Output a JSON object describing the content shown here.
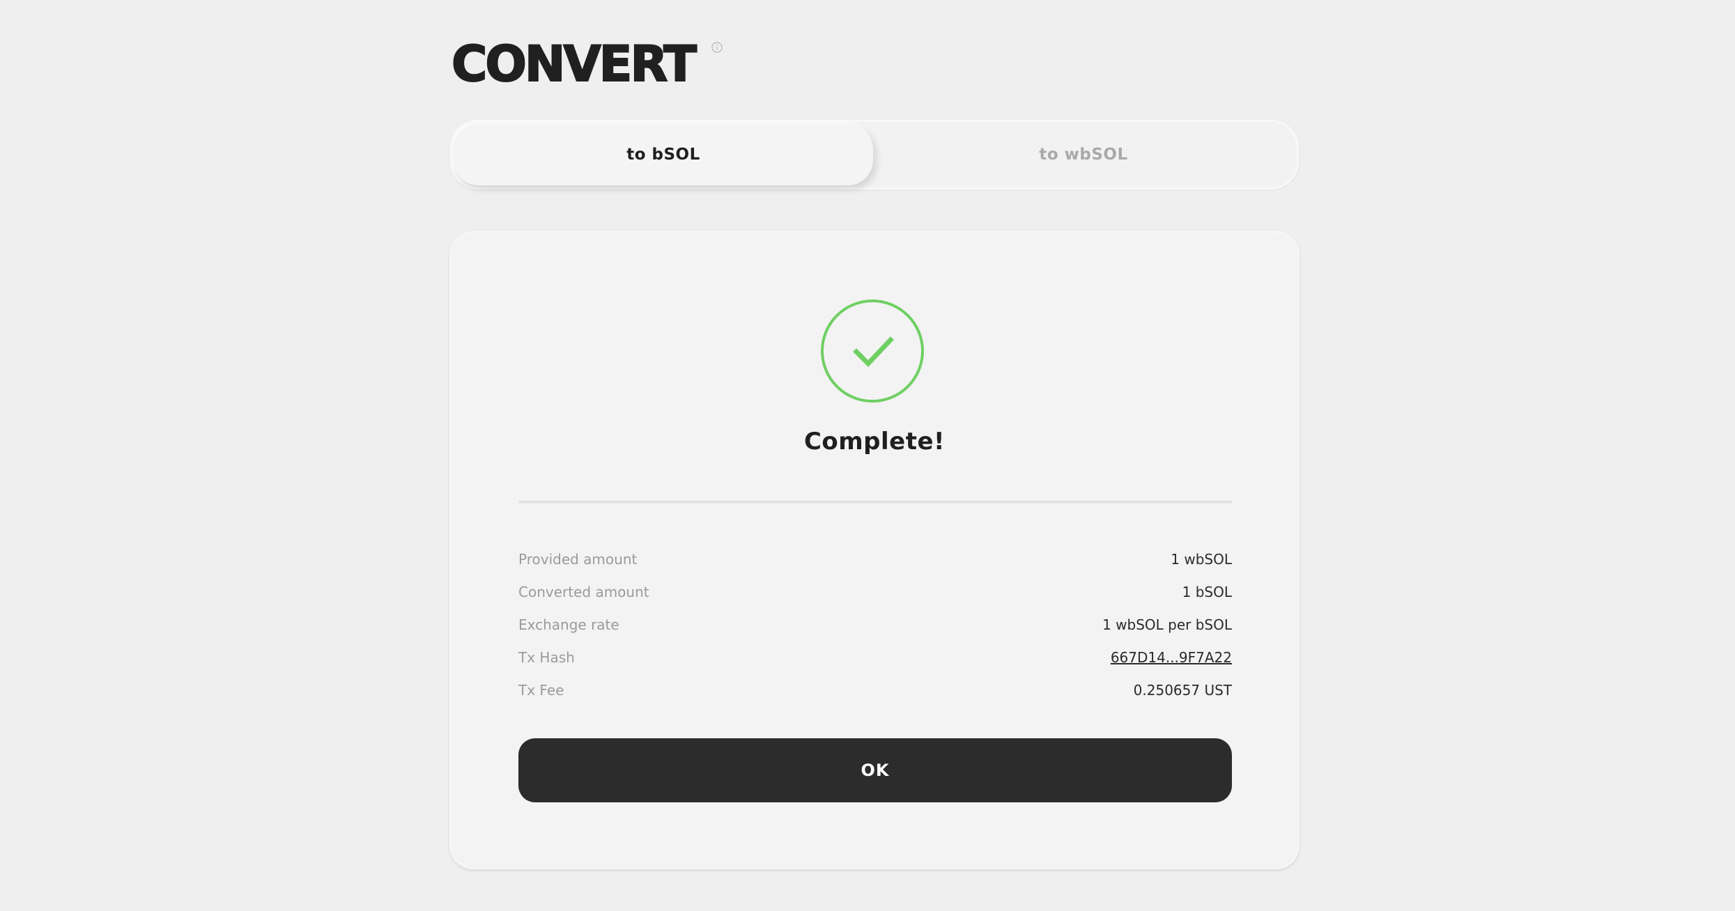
{
  "header": {
    "title": "CONVERT",
    "info_icon": "info-circle-icon"
  },
  "tabs": [
    {
      "label": "to bSOL",
      "active": true
    },
    {
      "label": "to wbSOL",
      "active": false
    }
  ],
  "result": {
    "icon": "check-circle-icon",
    "status": "Complete!",
    "rows": [
      {
        "label": "Provided amount",
        "value": "1 wbSOL"
      },
      {
        "label": "Converted amount",
        "value": "1 bSOL"
      },
      {
        "label": "Exchange rate",
        "value": "1 wbSOL per bSOL"
      },
      {
        "label": "Tx Hash",
        "value": "667D14...9F7A22"
      },
      {
        "label": "Tx Fee",
        "value": "0.250657 UST"
      }
    ],
    "button_label": "OK"
  },
  "colors": {
    "background": "#efefef",
    "success": "#6fcf63",
    "button": "#2c2c2c"
  }
}
